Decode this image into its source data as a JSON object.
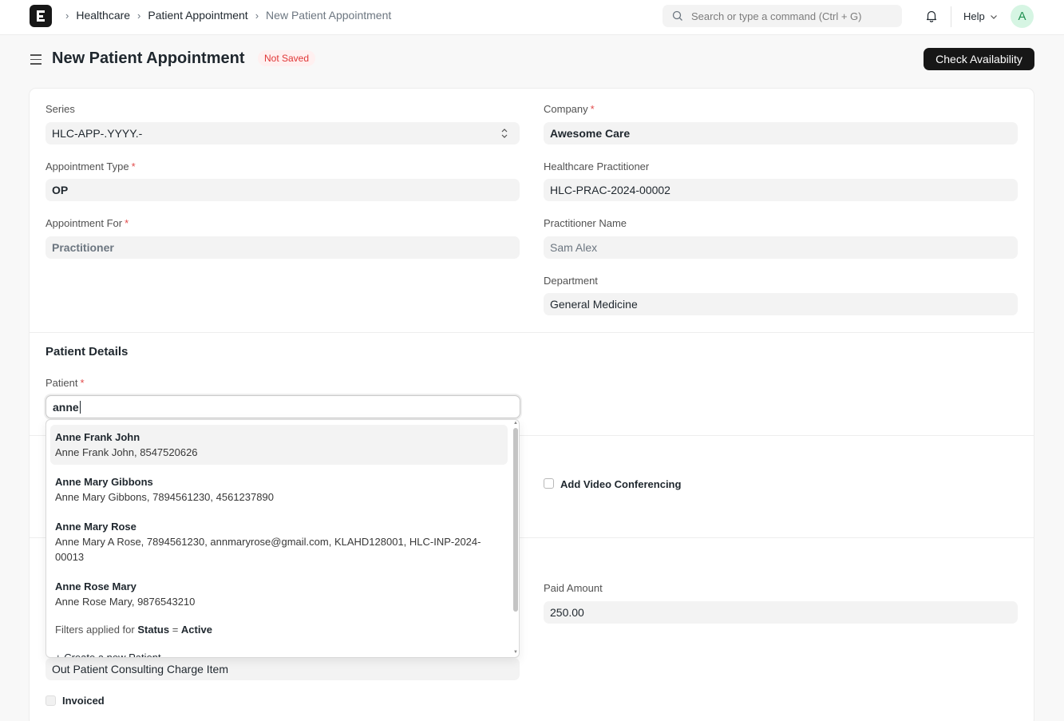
{
  "navbar": {
    "breadcrumbs": [
      "Healthcare",
      "Patient Appointment",
      "New Patient Appointment"
    ],
    "search_placeholder": "Search or type a command (Ctrl + G)",
    "help_label": "Help",
    "avatar_initial": "A"
  },
  "page": {
    "title": "New Patient Appointment",
    "status_badge": "Not Saved",
    "primary_action": "Check Availability"
  },
  "form": {
    "series": {
      "label": "Series",
      "value": "HLC-APP-.YYYY.-"
    },
    "company": {
      "label": "Company",
      "value": "Awesome Care"
    },
    "appointment_type": {
      "label": "Appointment Type",
      "value": "OP"
    },
    "healthcare_practitioner": {
      "label": "Healthcare Practitioner",
      "value": "HLC-PRAC-2024-00002"
    },
    "appointment_for": {
      "label": "Appointment For",
      "value": "Practitioner"
    },
    "practitioner_name": {
      "label": "Practitioner Name",
      "value": "Sam Alex"
    },
    "department": {
      "label": "Department",
      "value": "General Medicine"
    },
    "patient_section_title": "Patient Details",
    "patient": {
      "label": "Patient",
      "value": "anne"
    },
    "add_video_conferencing": {
      "label": "Add Video Conferencing",
      "checked": false
    },
    "paid_amount": {
      "label": "Paid Amount",
      "value": "250.00"
    },
    "billing_item": {
      "value": "Out Patient Consulting Charge Item"
    },
    "invoiced": {
      "label": "Invoiced",
      "checked": false
    }
  },
  "patient_dropdown": {
    "items": [
      {
        "title": "Anne Frank John",
        "desc": "Anne Frank John, 8547520626"
      },
      {
        "title": "Anne Mary Gibbons",
        "desc": "Anne Mary Gibbons, 7894561230, 4561237890"
      },
      {
        "title": "Anne Mary Rose",
        "desc": "Anne Mary A Rose, 7894561230, annmaryrose@gmail.com, KLAHD128001, HLC-INP-2024-00013"
      },
      {
        "title": "Anne Rose Mary",
        "desc": "Anne Rose Mary, 9876543210"
      }
    ],
    "filter_prefix": "Filters applied for",
    "filter_field": "Status",
    "filter_op": "=",
    "filter_value": "Active",
    "create_label": "+ Create a new Patient"
  }
}
